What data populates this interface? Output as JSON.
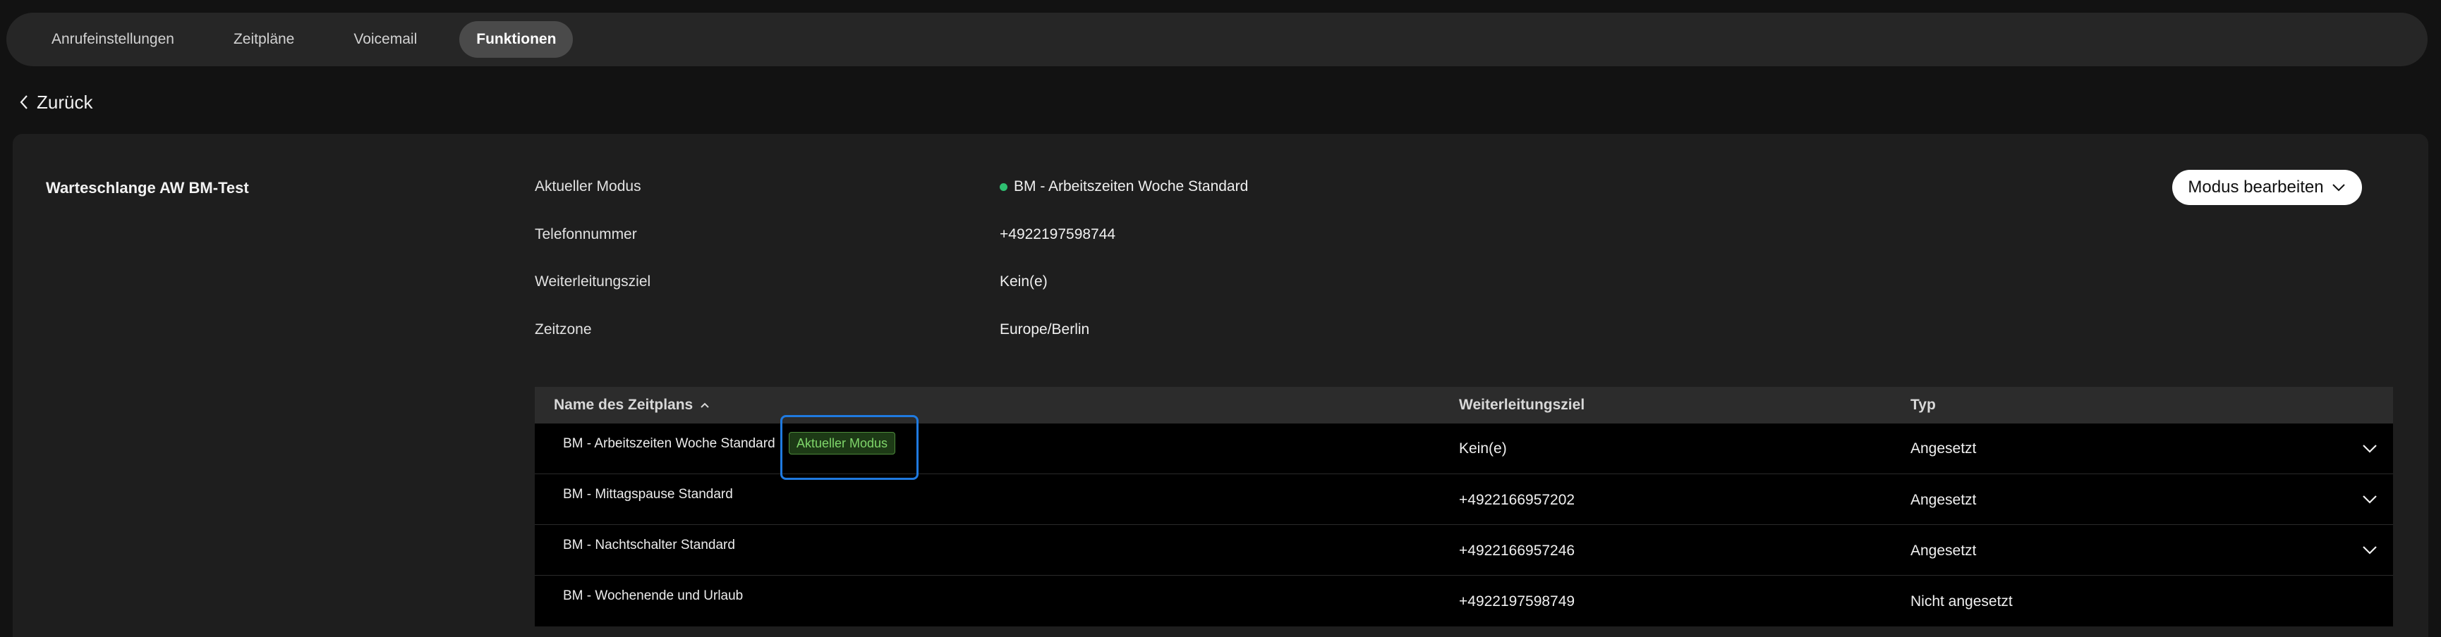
{
  "tabs": [
    {
      "label": "Anrufeinstellungen",
      "active": false
    },
    {
      "label": "Zeitpläne",
      "active": false
    },
    {
      "label": "Voicemail",
      "active": false
    },
    {
      "label": "Funktionen",
      "active": true
    }
  ],
  "back": {
    "label": "Zurück"
  },
  "queue": {
    "name": "Warteschlange AW BM-Test"
  },
  "info": {
    "mode_label": "Aktueller Modus",
    "mode_value": "BM - Arbeitszeiten Woche Standard",
    "mode_status_color": "#2fbf71",
    "phone_label": "Telefonnummer",
    "phone_value": "+4922197598744",
    "forward_label": "Weiterleitungsziel",
    "forward_value": "Kein(e)",
    "timezone_label": "Zeitzone",
    "timezone_value": "Europe/Berlin"
  },
  "edit_mode_button": {
    "label": "Modus bearbeiten"
  },
  "table": {
    "headers": {
      "name": "Name des Zeitplans",
      "forward": "Weiterleitungsziel",
      "type": "Typ"
    },
    "sort": {
      "column": "name",
      "direction": "ascending"
    },
    "rows": [
      {
        "name": "BM - Arbeitszeiten Woche Standard",
        "badge": "Aktueller Modus",
        "forward": "Kein(e)",
        "type": "Angesetzt",
        "expandable": true
      },
      {
        "name": "BM - Mittagspause Standard",
        "forward": "+4922166957202",
        "type": "Angesetzt",
        "expandable": true
      },
      {
        "name": "BM - Nachtschalter Standard",
        "forward": "+4922166957246",
        "type": "Angesetzt",
        "expandable": true
      },
      {
        "name": "BM - Wochenende und Urlaub",
        "forward": "+4922197598749",
        "type": "Nicht angesetzt",
        "expandable": false
      }
    ]
  }
}
